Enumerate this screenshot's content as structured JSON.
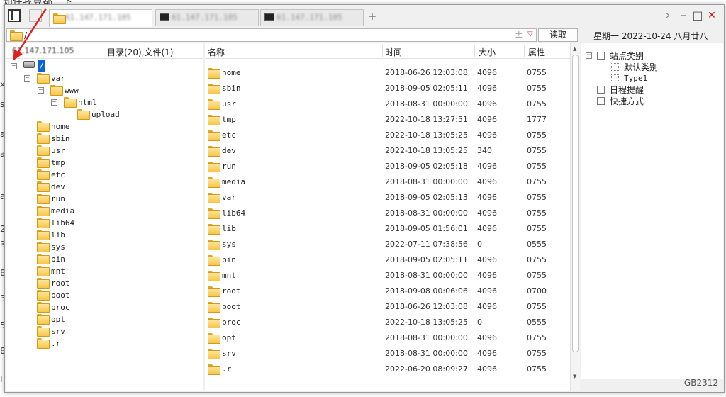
{
  "background": {
    "top_fragment": "知住我算都二下",
    "side_fragments": [
      "x",
      "s",
      "a",
      "a",
      "a",
      "2",
      "3",
      "8",
      "3",
      "5",
      "8",
      "I"
    ]
  },
  "tabs": [
    {
      "label": "61.147.171.105",
      "icon": "folder-icon",
      "active": true
    },
    {
      "label": "61.147.171.105",
      "icon": "terminal-icon",
      "active": false
    },
    {
      "label": "61.147.171.105",
      "icon": "terminal-icon",
      "active": false
    }
  ],
  "toolbar": {
    "add_tab": "+",
    "nav_forward": "›",
    "minimize": "—",
    "maximize": "□",
    "close": "✕"
  },
  "address": {
    "path": "/",
    "plus": "±",
    "dropdown": "▽",
    "read_button": "读取"
  },
  "date_display": "星期一  2022-10-24  八月廿八",
  "left_pane": {
    "host": "61.147.171.105",
    "counts": "目录(20),文件(1)",
    "tree": [
      {
        "label": "/",
        "depth": 0,
        "expander": "−",
        "icon": "drive-icon",
        "selected": true
      },
      {
        "label": "var",
        "depth": 1,
        "expander": "−",
        "icon": "folder-icon"
      },
      {
        "label": "www",
        "depth": 2,
        "expander": "−",
        "icon": "folder-icon"
      },
      {
        "label": "html",
        "depth": 3,
        "expander": "−",
        "icon": "folder-icon"
      },
      {
        "label": "upload",
        "depth": 4,
        "expander": "",
        "icon": "folder-icon"
      },
      {
        "label": "home",
        "depth": 1,
        "expander": "",
        "icon": "folder-icon"
      },
      {
        "label": "sbin",
        "depth": 1,
        "expander": "",
        "icon": "folder-icon"
      },
      {
        "label": "usr",
        "depth": 1,
        "expander": "",
        "icon": "folder-icon"
      },
      {
        "label": "tmp",
        "depth": 1,
        "expander": "",
        "icon": "folder-icon"
      },
      {
        "label": "etc",
        "depth": 1,
        "expander": "",
        "icon": "folder-icon"
      },
      {
        "label": "dev",
        "depth": 1,
        "expander": "",
        "icon": "folder-icon"
      },
      {
        "label": "run",
        "depth": 1,
        "expander": "",
        "icon": "folder-icon"
      },
      {
        "label": "media",
        "depth": 1,
        "expander": "",
        "icon": "folder-icon"
      },
      {
        "label": "lib64",
        "depth": 1,
        "expander": "",
        "icon": "folder-icon"
      },
      {
        "label": "lib",
        "depth": 1,
        "expander": "",
        "icon": "folder-icon"
      },
      {
        "label": "sys",
        "depth": 1,
        "expander": "",
        "icon": "folder-icon"
      },
      {
        "label": "bin",
        "depth": 1,
        "expander": "",
        "icon": "folder-icon"
      },
      {
        "label": "mnt",
        "depth": 1,
        "expander": "",
        "icon": "folder-icon"
      },
      {
        "label": "root",
        "depth": 1,
        "expander": "",
        "icon": "folder-icon"
      },
      {
        "label": "boot",
        "depth": 1,
        "expander": "",
        "icon": "folder-icon"
      },
      {
        "label": "proc",
        "depth": 1,
        "expander": "",
        "icon": "folder-icon"
      },
      {
        "label": "opt",
        "depth": 1,
        "expander": "",
        "icon": "folder-icon"
      },
      {
        "label": "srv",
        "depth": 1,
        "expander": "",
        "icon": "folder-icon"
      },
      {
        "label": ".r",
        "depth": 1,
        "expander": "",
        "icon": "folder-icon"
      }
    ]
  },
  "file_list": {
    "columns": [
      "名称",
      "时间",
      "大小",
      "属性"
    ],
    "rows": [
      {
        "name": "home",
        "time": "2018-06-26 12:03:08",
        "size": "4096",
        "attr": "0755"
      },
      {
        "name": "sbin",
        "time": "2018-09-05 02:05:11",
        "size": "4096",
        "attr": "0755"
      },
      {
        "name": "usr",
        "time": "2018-08-31 00:00:00",
        "size": "4096",
        "attr": "0755"
      },
      {
        "name": "tmp",
        "time": "2022-10-18 13:27:51",
        "size": "4096",
        "attr": "1777"
      },
      {
        "name": "etc",
        "time": "2022-10-18 13:05:25",
        "size": "4096",
        "attr": "0755"
      },
      {
        "name": "dev",
        "time": "2022-10-18 13:05:25",
        "size": "340",
        "attr": "0755"
      },
      {
        "name": "run",
        "time": "2018-09-05 02:05:18",
        "size": "4096",
        "attr": "0755"
      },
      {
        "name": "media",
        "time": "2018-08-31 00:00:00",
        "size": "4096",
        "attr": "0755"
      },
      {
        "name": "var",
        "time": "2018-09-05 02:05:13",
        "size": "4096",
        "attr": "0755"
      },
      {
        "name": "lib64",
        "time": "2018-08-31 00:00:00",
        "size": "4096",
        "attr": "0755"
      },
      {
        "name": "lib",
        "time": "2018-09-05 01:56:01",
        "size": "4096",
        "attr": "0755"
      },
      {
        "name": "sys",
        "time": "2022-07-11 07:38:56",
        "size": "0",
        "attr": "0555"
      },
      {
        "name": "bin",
        "time": "2018-09-05 02:05:11",
        "size": "4096",
        "attr": "0755"
      },
      {
        "name": "mnt",
        "time": "2018-08-31 00:00:00",
        "size": "4096",
        "attr": "0755"
      },
      {
        "name": "root",
        "time": "2018-09-08 00:06:06",
        "size": "4096",
        "attr": "0700"
      },
      {
        "name": "boot",
        "time": "2018-06-26 12:03:08",
        "size": "4096",
        "attr": "0755"
      },
      {
        "name": "proc",
        "time": "2022-10-18 13:05:25",
        "size": "0",
        "attr": "0555"
      },
      {
        "name": "opt",
        "time": "2018-08-31 00:00:00",
        "size": "4096",
        "attr": "0755"
      },
      {
        "name": "srv",
        "time": "2018-08-31 00:00:00",
        "size": "4096",
        "attr": "0755"
      },
      {
        "name": ".r",
        "time": "2022-06-20 08:09:27",
        "size": "4096",
        "attr": "0755"
      }
    ]
  },
  "right_pane": {
    "items": [
      {
        "label": "站点类别",
        "depth": 0,
        "expander": "−",
        "icon": "category-icon"
      },
      {
        "label": "默认类别",
        "depth": 1,
        "expander": "",
        "icon": "page-icon"
      },
      {
        "label": "Type1",
        "depth": 1,
        "expander": "",
        "icon": "page-icon"
      },
      {
        "label": "日程提醒",
        "depth": 0,
        "expander": "",
        "icon": "schedule-icon"
      },
      {
        "label": "快捷方式",
        "depth": 0,
        "expander": "",
        "icon": "shortcut-icon"
      }
    ]
  },
  "status": {
    "encoding": "GB2312"
  },
  "colors": {
    "accent": "#0a64d8",
    "folder": "#f6c64a",
    "close": "#cc2222"
  }
}
